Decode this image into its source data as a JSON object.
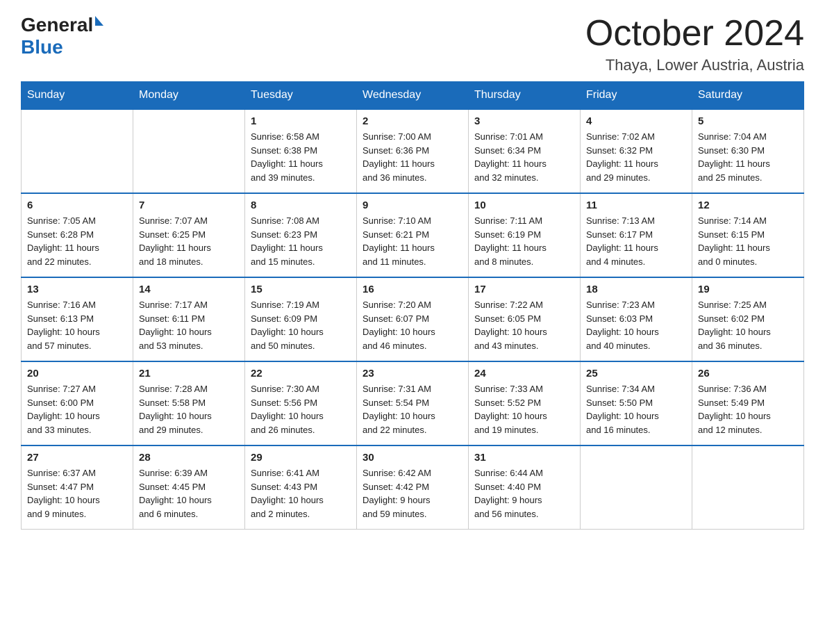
{
  "header": {
    "logo_general": "General",
    "logo_blue": "Blue",
    "month_title": "October 2024",
    "location": "Thaya, Lower Austria, Austria"
  },
  "weekdays": [
    "Sunday",
    "Monday",
    "Tuesday",
    "Wednesday",
    "Thursday",
    "Friday",
    "Saturday"
  ],
  "weeks": [
    [
      {
        "day": "",
        "info": ""
      },
      {
        "day": "",
        "info": ""
      },
      {
        "day": "1",
        "info": "Sunrise: 6:58 AM\nSunset: 6:38 PM\nDaylight: 11 hours\nand 39 minutes."
      },
      {
        "day": "2",
        "info": "Sunrise: 7:00 AM\nSunset: 6:36 PM\nDaylight: 11 hours\nand 36 minutes."
      },
      {
        "day": "3",
        "info": "Sunrise: 7:01 AM\nSunset: 6:34 PM\nDaylight: 11 hours\nand 32 minutes."
      },
      {
        "day": "4",
        "info": "Sunrise: 7:02 AM\nSunset: 6:32 PM\nDaylight: 11 hours\nand 29 minutes."
      },
      {
        "day": "5",
        "info": "Sunrise: 7:04 AM\nSunset: 6:30 PM\nDaylight: 11 hours\nand 25 minutes."
      }
    ],
    [
      {
        "day": "6",
        "info": "Sunrise: 7:05 AM\nSunset: 6:28 PM\nDaylight: 11 hours\nand 22 minutes."
      },
      {
        "day": "7",
        "info": "Sunrise: 7:07 AM\nSunset: 6:25 PM\nDaylight: 11 hours\nand 18 minutes."
      },
      {
        "day": "8",
        "info": "Sunrise: 7:08 AM\nSunset: 6:23 PM\nDaylight: 11 hours\nand 15 minutes."
      },
      {
        "day": "9",
        "info": "Sunrise: 7:10 AM\nSunset: 6:21 PM\nDaylight: 11 hours\nand 11 minutes."
      },
      {
        "day": "10",
        "info": "Sunrise: 7:11 AM\nSunset: 6:19 PM\nDaylight: 11 hours\nand 8 minutes."
      },
      {
        "day": "11",
        "info": "Sunrise: 7:13 AM\nSunset: 6:17 PM\nDaylight: 11 hours\nand 4 minutes."
      },
      {
        "day": "12",
        "info": "Sunrise: 7:14 AM\nSunset: 6:15 PM\nDaylight: 11 hours\nand 0 minutes."
      }
    ],
    [
      {
        "day": "13",
        "info": "Sunrise: 7:16 AM\nSunset: 6:13 PM\nDaylight: 10 hours\nand 57 minutes."
      },
      {
        "day": "14",
        "info": "Sunrise: 7:17 AM\nSunset: 6:11 PM\nDaylight: 10 hours\nand 53 minutes."
      },
      {
        "day": "15",
        "info": "Sunrise: 7:19 AM\nSunset: 6:09 PM\nDaylight: 10 hours\nand 50 minutes."
      },
      {
        "day": "16",
        "info": "Sunrise: 7:20 AM\nSunset: 6:07 PM\nDaylight: 10 hours\nand 46 minutes."
      },
      {
        "day": "17",
        "info": "Sunrise: 7:22 AM\nSunset: 6:05 PM\nDaylight: 10 hours\nand 43 minutes."
      },
      {
        "day": "18",
        "info": "Sunrise: 7:23 AM\nSunset: 6:03 PM\nDaylight: 10 hours\nand 40 minutes."
      },
      {
        "day": "19",
        "info": "Sunrise: 7:25 AM\nSunset: 6:02 PM\nDaylight: 10 hours\nand 36 minutes."
      }
    ],
    [
      {
        "day": "20",
        "info": "Sunrise: 7:27 AM\nSunset: 6:00 PM\nDaylight: 10 hours\nand 33 minutes."
      },
      {
        "day": "21",
        "info": "Sunrise: 7:28 AM\nSunset: 5:58 PM\nDaylight: 10 hours\nand 29 minutes."
      },
      {
        "day": "22",
        "info": "Sunrise: 7:30 AM\nSunset: 5:56 PM\nDaylight: 10 hours\nand 26 minutes."
      },
      {
        "day": "23",
        "info": "Sunrise: 7:31 AM\nSunset: 5:54 PM\nDaylight: 10 hours\nand 22 minutes."
      },
      {
        "day": "24",
        "info": "Sunrise: 7:33 AM\nSunset: 5:52 PM\nDaylight: 10 hours\nand 19 minutes."
      },
      {
        "day": "25",
        "info": "Sunrise: 7:34 AM\nSunset: 5:50 PM\nDaylight: 10 hours\nand 16 minutes."
      },
      {
        "day": "26",
        "info": "Sunrise: 7:36 AM\nSunset: 5:49 PM\nDaylight: 10 hours\nand 12 minutes."
      }
    ],
    [
      {
        "day": "27",
        "info": "Sunrise: 6:37 AM\nSunset: 4:47 PM\nDaylight: 10 hours\nand 9 minutes."
      },
      {
        "day": "28",
        "info": "Sunrise: 6:39 AM\nSunset: 4:45 PM\nDaylight: 10 hours\nand 6 minutes."
      },
      {
        "day": "29",
        "info": "Sunrise: 6:41 AM\nSunset: 4:43 PM\nDaylight: 10 hours\nand 2 minutes."
      },
      {
        "day": "30",
        "info": "Sunrise: 6:42 AM\nSunset: 4:42 PM\nDaylight: 9 hours\nand 59 minutes."
      },
      {
        "day": "31",
        "info": "Sunrise: 6:44 AM\nSunset: 4:40 PM\nDaylight: 9 hours\nand 56 minutes."
      },
      {
        "day": "",
        "info": ""
      },
      {
        "day": "",
        "info": ""
      }
    ]
  ]
}
